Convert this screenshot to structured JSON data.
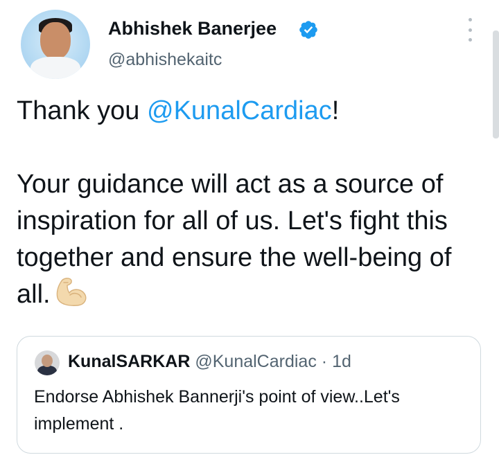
{
  "author": {
    "display_name": "Abhishek Banerjee",
    "handle": "@abhishekaitc",
    "verified": true
  },
  "tweet": {
    "text_before_mention": "Thank you ",
    "mention": "@KunalCardiac",
    "text_after_mention": "!",
    "paragraph_2": "Your guidance will act as a source of inspiration for all of us. Let's fight this together and ensure the well-being of all.",
    "emoji": "flexed-biceps"
  },
  "quoted_tweet": {
    "display_name": "KunalSARKAR",
    "handle": "@KunalCardiac",
    "separator": "·",
    "timestamp": "1d",
    "text": "Endorse Abhishek Bannerji's point of view..Let's implement ."
  },
  "colors": {
    "text": "#0f1419",
    "secondary_text": "#536471",
    "link": "#1d9bf0",
    "verified_badge": "#1d9bf0",
    "border": "#cfd9de"
  },
  "icons": {
    "verified": "verified-badge-icon",
    "more": "more-options-icon",
    "emoji": "flexed-biceps-icon"
  }
}
